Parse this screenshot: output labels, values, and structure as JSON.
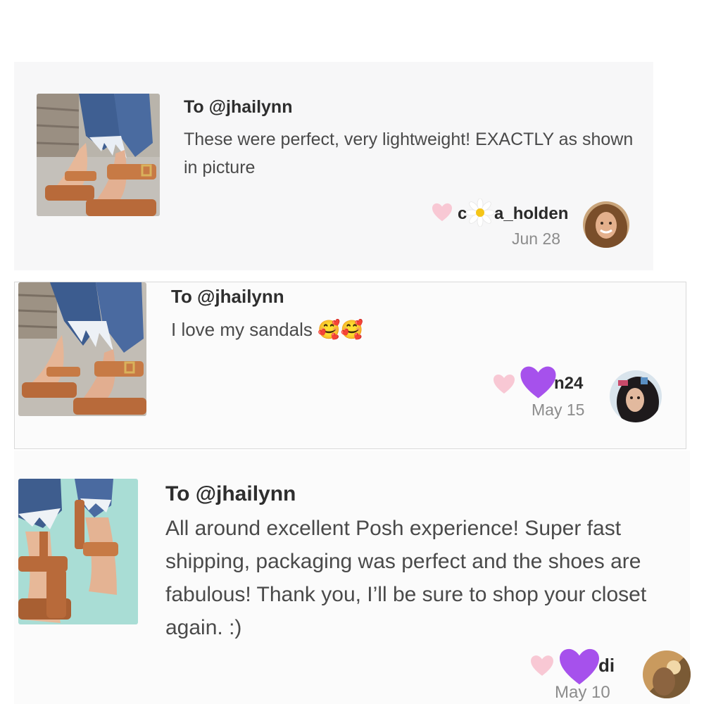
{
  "reviews": [
    {
      "to": "To @jhailynn",
      "message": "These were perfect, very lightweight! EXACTLY as shown in picture",
      "username_start": "c",
      "username_end": "a_holden",
      "date": "Jun 28",
      "overlay_icon": "daisy-icon"
    },
    {
      "to": "To @jhailynn",
      "message": "I love my sandals",
      "message_emoji": "🥰🥰",
      "username_end": "n24",
      "date": "May 15",
      "overlay_icon": "purple-heart-icon"
    },
    {
      "to": "To @jhailynn",
      "message": "All around excellent Posh experience! Super fast shipping, packaging was perfect and the shoes are fabulous! Thank you, I’ll be sure to shop your closet again. :)",
      "username_end": "di",
      "date": "May 10",
      "overlay_icon": "purple-heart-icon"
    }
  ],
  "colors": {
    "like_heart": "#f8c8d4",
    "purple_heart": "#a651ec",
    "card_bg": "#f7f7f8",
    "sandal_tan": "#b86a3a"
  }
}
